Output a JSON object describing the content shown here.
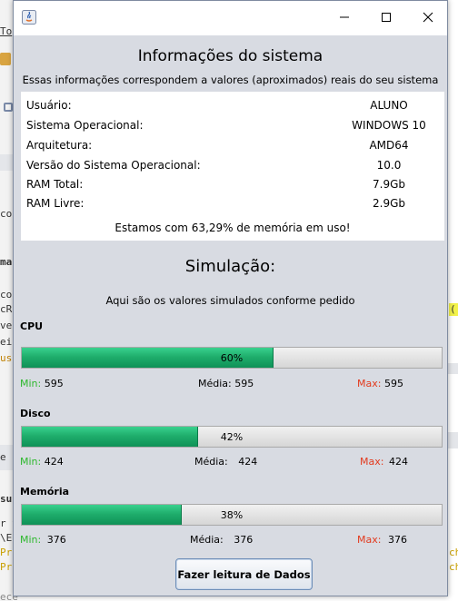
{
  "window": {
    "controls": {
      "minimize_icon": "minimize-icon",
      "maximize_icon": "maximize-icon",
      "close_icon": "close-icon"
    }
  },
  "system_info": {
    "title": "Informações do sistema",
    "subtitle": "Essas informações correspondem a valores (aproximados) reais do seu sistema",
    "rows": [
      {
        "label": "Usuário:",
        "value": "ALUNO"
      },
      {
        "label": "Sistema Operacional:",
        "value": "WINDOWS 10"
      },
      {
        "label": "Arquitetura:",
        "value": "AMD64"
      },
      {
        "label": "Versão do Sistema Operacional:",
        "value": "10.0"
      },
      {
        "label": "RAM Total:",
        "value": "7.9Gb"
      },
      {
        "label": "RAM Livre:",
        "value": "2.9Gb"
      }
    ],
    "memory_usage": "Estamos com 63,29% de memória em uso!"
  },
  "simulation": {
    "title": "Simulação:",
    "subtitle": "Aqui são os valores simulados conforme pedido",
    "min_label": "Min:",
    "avg_label": "Média:",
    "max_label": "Max:",
    "sections": [
      {
        "label": "CPU",
        "percent_text": "60%",
        "progress": 0.6,
        "min": "595",
        "avg": "595",
        "max": "595"
      },
      {
        "label": "Disco",
        "percent_text": "42%",
        "progress": 0.42,
        "min": "424",
        "avg": "424",
        "max": "424"
      },
      {
        "label": "Memória",
        "percent_text": "38%",
        "progress": 0.38,
        "min": "376",
        "avg": "376",
        "max": "376"
      }
    ]
  },
  "read_button_label": "Fazer leitura de Dados",
  "colors": {
    "progress_fill": "#1fae6c",
    "min_label": "#2db82d",
    "max_label": "#e23a1e",
    "dialog_background": "#d8dbe2"
  },
  "background_ide": {
    "fragments": [
      "To",
      "cor",
      "ma",
      "co",
      "cR",
      "ver",
      "ei",
      "us",
      "e",
      "su)",
      "r t",
      "\\E",
      "Pr",
      "Pr",
      "(",
      "ch",
      "ch",
      "ece"
    ]
  }
}
